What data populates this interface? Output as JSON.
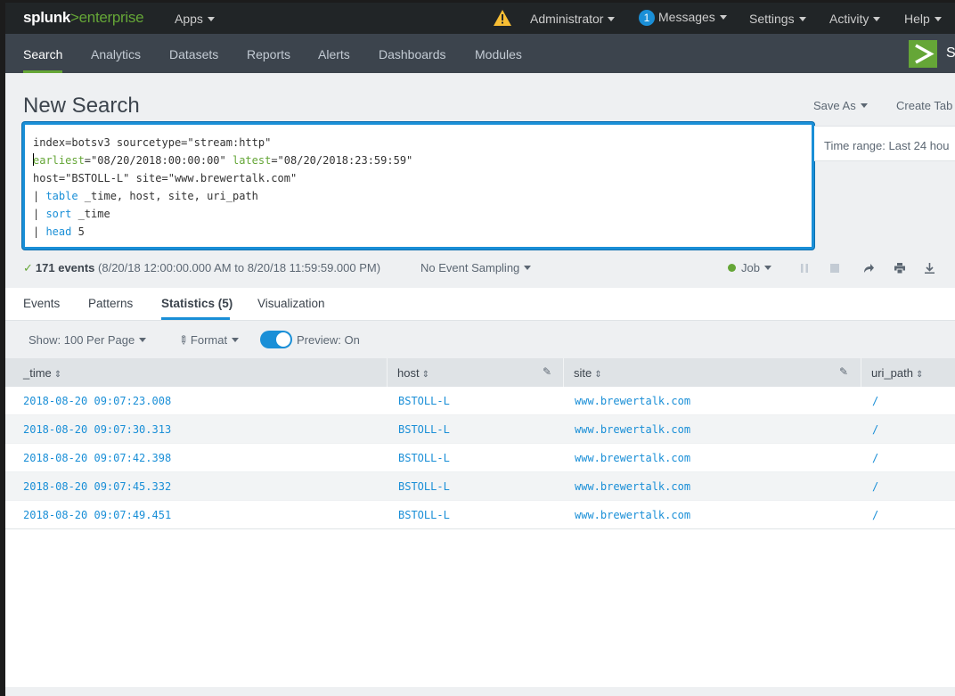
{
  "topbar": {
    "logo_main": "splunk",
    "logo_gt": ">",
    "logo_product": "enterprise",
    "apps": "Apps",
    "user": "Administrator",
    "messages_count": "1",
    "messages": "Messages",
    "settings": "Settings",
    "activity": "Activity",
    "help": "Help"
  },
  "appbar": {
    "tabs": [
      "Search",
      "Analytics",
      "Datasets",
      "Reports",
      "Alerts",
      "Dashboards",
      "Modules"
    ],
    "active_tab": "Search",
    "app_letter": "S"
  },
  "page": {
    "title": "New Search",
    "save_as": "Save As",
    "create_table": "Create Tab"
  },
  "search": {
    "line1": "index=botsv3 sourcetype=\"stream:http\"",
    "line2_kw1": "earliest",
    "line2_v1": "=\"08/20/2018:00:00:00\" ",
    "line2_kw2": "latest",
    "line2_v2": "=\"08/20/2018:23:59:59\"",
    "line3": "host=\"BSTOLL-L\" site=\"www.brewertalk.com\"",
    "pipe": "| ",
    "cmd_table": "table",
    "args_table": " _time, host, site, uri_path",
    "cmd_sort": "sort",
    "args_sort": " _time",
    "cmd_head": "head",
    "args_head": " 5"
  },
  "time_range": "Time range: Last 24 hou",
  "status": {
    "check": "✓",
    "count": "171 events",
    "range": " (8/20/18 12:00:00.000 AM to 8/20/18 11:59:59.000 PM)",
    "sampling": "No Event Sampling",
    "job": "Job"
  },
  "result_tabs": [
    "Events",
    "Patterns",
    "Statistics (5)",
    "Visualization"
  ],
  "toolbar": {
    "show": "Show: 100 Per Page",
    "format": "Format",
    "preview": "Preview: On",
    "preview_on": true
  },
  "table": {
    "columns": [
      "_time",
      "host",
      "site",
      "uri_path"
    ],
    "rows": [
      [
        "2018-08-20 09:07:23.008",
        "BSTOLL-L",
        "www.brewertalk.com",
        "/"
      ],
      [
        "2018-08-20 09:07:30.313",
        "BSTOLL-L",
        "www.brewertalk.com",
        "/"
      ],
      [
        "2018-08-20 09:07:42.398",
        "BSTOLL-L",
        "www.brewertalk.com",
        "/"
      ],
      [
        "2018-08-20 09:07:45.332",
        "BSTOLL-L",
        "www.brewertalk.com",
        "/"
      ],
      [
        "2018-08-20 09:07:49.451",
        "BSTOLL-L",
        "www.brewertalk.com",
        "/"
      ]
    ]
  },
  "colors": {
    "accent_green": "#65a637",
    "accent_blue": "#1a8fd7",
    "topbar_bg": "#212527",
    "appbar_bg": "#3c444d"
  }
}
